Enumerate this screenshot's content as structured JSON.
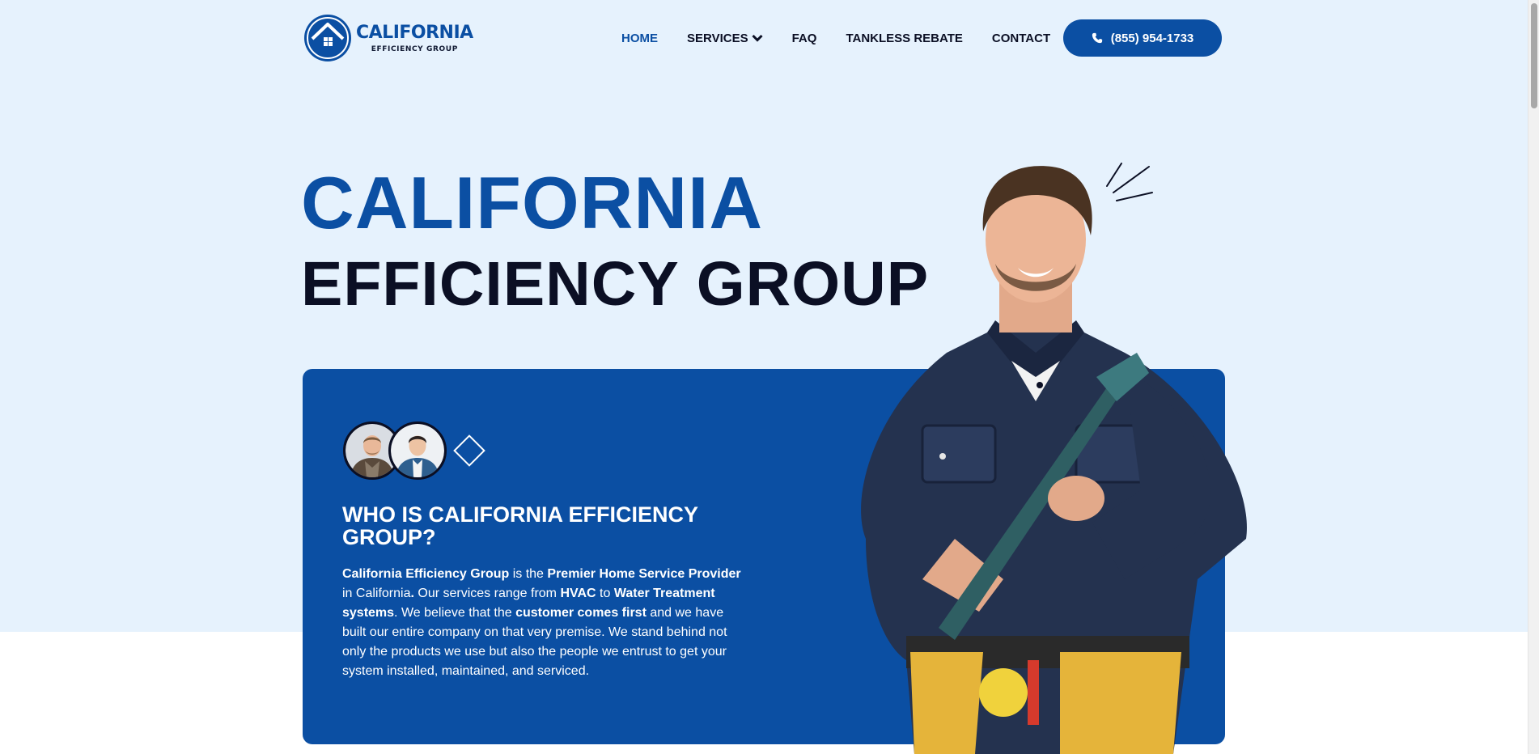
{
  "header": {
    "logo": {
      "title": "CALIFORNIA",
      "subtitle": "EFFICIENCY GROUP"
    },
    "nav": [
      {
        "label": "HOME",
        "active": true
      },
      {
        "label": "SERVICES",
        "has_dropdown": true
      },
      {
        "label": "FAQ"
      },
      {
        "label": "TANKLESS REBATE"
      },
      {
        "label": "CONTACT"
      }
    ],
    "phone_button": {
      "label": "(855) 954-1733",
      "icon": "phone-icon"
    }
  },
  "hero": {
    "title_line1": "CALIFORNIA",
    "title_line2": "EFFICIENCY GROUP"
  },
  "card": {
    "title": "WHO IS CALIFORNIA EFFICIENCY GROUP?",
    "paragraph": [
      {
        "text": "California Efficiency Group",
        "bold": true
      },
      {
        "text": " is the ",
        "bold": false
      },
      {
        "text": "Premier Home Service Provider",
        "bold": true
      },
      {
        "text": " in California",
        "bold": false
      },
      {
        "text": ".",
        "bold": true
      },
      {
        "text": " Our services range from ",
        "bold": false
      },
      {
        "text": "HVAC",
        "bold": true
      },
      {
        "text": " to ",
        "bold": false
      },
      {
        "text": "Water Treatment systems",
        "bold": true
      },
      {
        "text": ". We believe that the ",
        "bold": false
      },
      {
        "text": "customer comes first",
        "bold": true
      },
      {
        "text": " and we have built our entire company on that very premise. We stand behind not only the products we use but also the people we entrust to get your system installed, maintained, and serviced.",
        "bold": false
      }
    ]
  },
  "colors": {
    "brand_blue": "#0b4fa3",
    "dark_navy": "#0b0f24",
    "hero_bg": "#e6f2fd",
    "white": "#ffffff"
  }
}
